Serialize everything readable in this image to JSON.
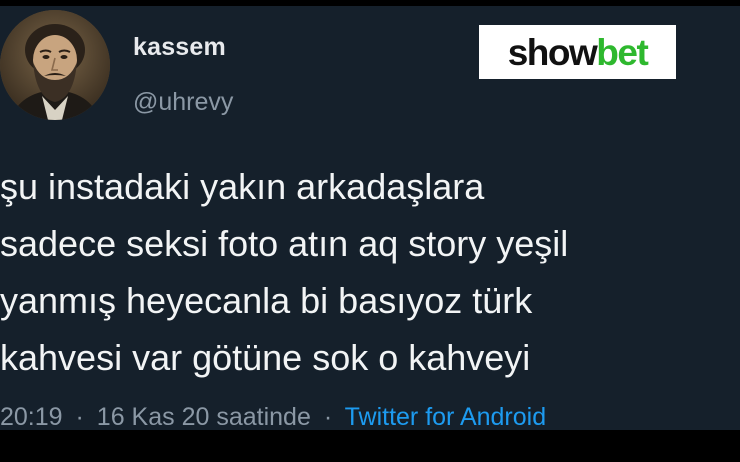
{
  "user": {
    "display_name": "kassem",
    "handle": "@uhrevy",
    "avatar_icon": "portrait-avatar"
  },
  "brand": {
    "part1": "show",
    "part2": "bet",
    "color_dark": "#111111",
    "color_green": "#2eb82e"
  },
  "tweet": {
    "lines": [
      "şu instadaki yakın arkadaşlara",
      "sadece seksi foto atın aq story yeşil",
      "yanmış heyecanla bi basıyoz türk",
      "kahvesi var götüne sok o kahveyi"
    ],
    "time": "20:19",
    "separator": "·",
    "date": "16 Kas 20 saatinde",
    "source": "Twitter for Android"
  },
  "colors": {
    "background": "#15202b",
    "text": "#f2f4f5",
    "muted": "#8b98a5",
    "link": "#1d9bf0"
  }
}
